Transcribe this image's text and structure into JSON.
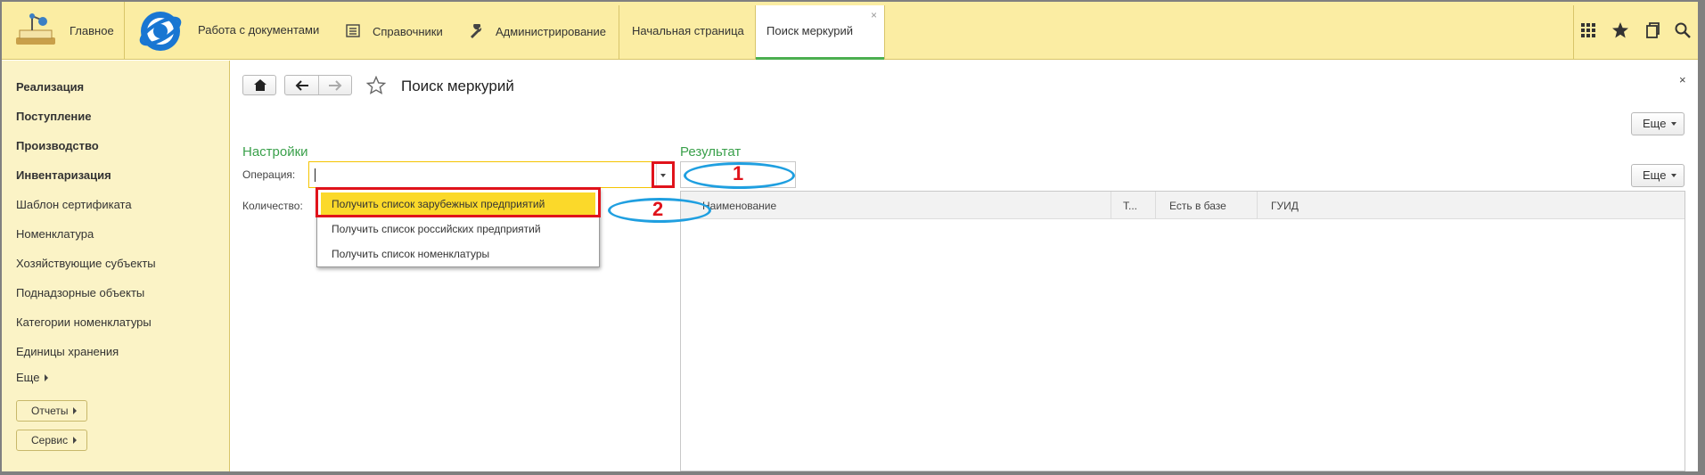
{
  "topbar": {
    "home_label": "Главное",
    "menu": [
      {
        "label": "Работа с документами",
        "icon": "brand-logo-icon"
      },
      {
        "label": "Справочники",
        "icon": "list-icon"
      },
      {
        "label": "Администрирование",
        "icon": "wrench-icon"
      }
    ],
    "tabs": [
      {
        "label": "Начальная страница",
        "active": false
      },
      {
        "label": "Поиск меркурий",
        "active": true,
        "close": "×"
      }
    ],
    "right_icons": [
      "apps-grid-icon",
      "star-icon",
      "history-icon",
      "search-icon"
    ]
  },
  "sidebar": {
    "items": [
      {
        "label": "Реализация",
        "bold": true
      },
      {
        "label": "Поступление",
        "bold": true
      },
      {
        "label": "Производство",
        "bold": true
      },
      {
        "label": "Инвентаризация",
        "bold": true
      },
      {
        "label": "Шаблон сертификата",
        "bold": false
      },
      {
        "label": "Номенклатура",
        "bold": false
      },
      {
        "label": "Хозяйствующие субъекты",
        "bold": false
      },
      {
        "label": "Поднадзорные объекты",
        "bold": false
      },
      {
        "label": "Категории номенклатуры",
        "bold": false
      },
      {
        "label": "Единицы хранения",
        "bold": false
      }
    ],
    "more_label": "Еще",
    "buttons": [
      {
        "label": "Отчеты"
      },
      {
        "label": "Сервис"
      }
    ]
  },
  "page": {
    "title": "Поиск меркурий",
    "close": "×",
    "more_label": "Еще"
  },
  "settings": {
    "title": "Настройки",
    "operation_label": "Операция:",
    "operation_value": "",
    "quantity_label": "Количество:"
  },
  "dropdown": {
    "options": [
      "Получить список зарубежных предприятий",
      "Получить список российских предприятий",
      "Получить список номенклатуры"
    ],
    "selected_index": 0
  },
  "result": {
    "title": "Результат",
    "more_label": "Еще",
    "columns": [
      "Наименование",
      "Т...",
      "Есть в базе",
      "ГУИД"
    ]
  },
  "annotations": {
    "marker1": "1",
    "marker2": "2",
    "colors": {
      "ellipse": "#1f9fe0",
      "highlight": "#e0131b"
    }
  },
  "colors": {
    "topbar_bg": "#fbeda3",
    "sidebar_bg": "#fbf3c6",
    "section_title": "#3aa04b",
    "input_focus": "#f5c400",
    "dropdown_selected": "#fbd92a"
  }
}
